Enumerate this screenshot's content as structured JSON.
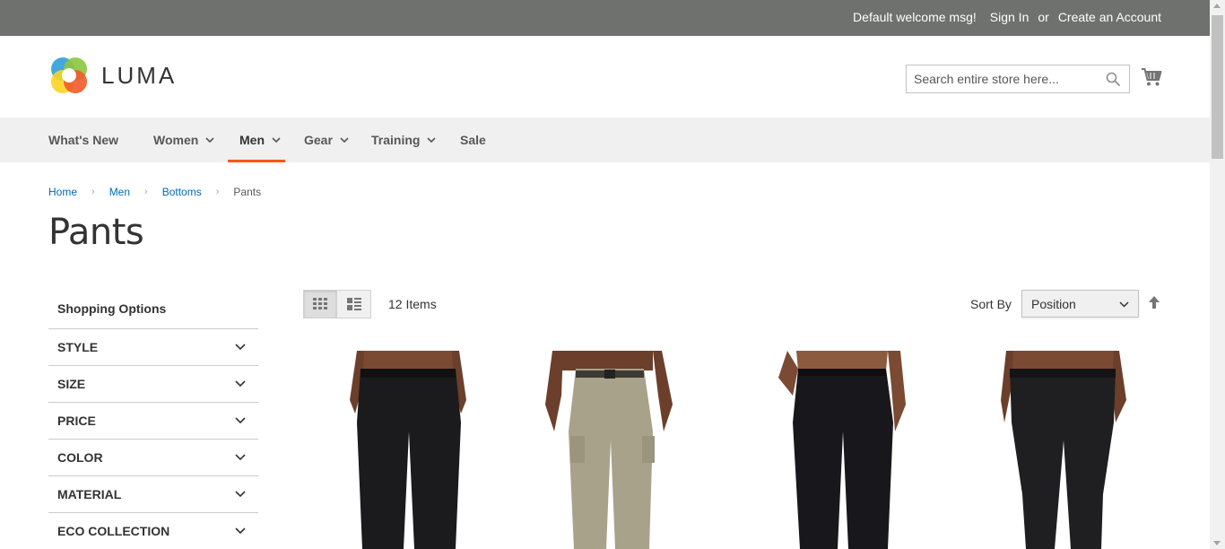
{
  "top_panel": {
    "welcome": "Default welcome msg!",
    "sign_in": "Sign In",
    "or": "or",
    "create_account": "Create an Account",
    "bg_color": "#6e716e"
  },
  "header": {
    "logo_text": "LUMA",
    "search_placeholder": "Search entire store here...",
    "search_icon": "search-icon",
    "cart_icon": "shopping-cart-icon"
  },
  "nav": {
    "items": [
      {
        "label": "What's New",
        "has_dropdown": false
      },
      {
        "label": "Women",
        "has_dropdown": true
      },
      {
        "label": "Men",
        "has_dropdown": true,
        "active": true
      },
      {
        "label": "Gear",
        "has_dropdown": true
      },
      {
        "label": "Training",
        "has_dropdown": true
      },
      {
        "label": "Sale",
        "has_dropdown": false
      }
    ],
    "active_color": "#ff5501"
  },
  "breadcrumb": {
    "items": [
      "Home",
      "Men",
      "Bottoms"
    ],
    "current": "Pants",
    "separator": "›"
  },
  "page_title": "Pants",
  "sidebar": {
    "title": "Shopping Options",
    "filters": [
      "STYLE",
      "SIZE",
      "PRICE",
      "COLOR",
      "MATERIAL",
      "ECO COLLECTION"
    ]
  },
  "toolbar": {
    "modes": [
      "grid",
      "list"
    ],
    "active_mode": "grid",
    "item_count": "12 Items",
    "sort_label": "Sort By",
    "sort_value": "Position",
    "sort_direction_icon": "arrow-up-icon"
  },
  "products": [
    {
      "color": "#1b1b1d",
      "style": "black-track-pants"
    },
    {
      "color": "#a8a28b",
      "style": "khaki-cargo-pants"
    },
    {
      "color": "#18181c",
      "style": "black-track-pants"
    },
    {
      "color": "#1f1f21",
      "style": "black-tight-pants"
    }
  ]
}
